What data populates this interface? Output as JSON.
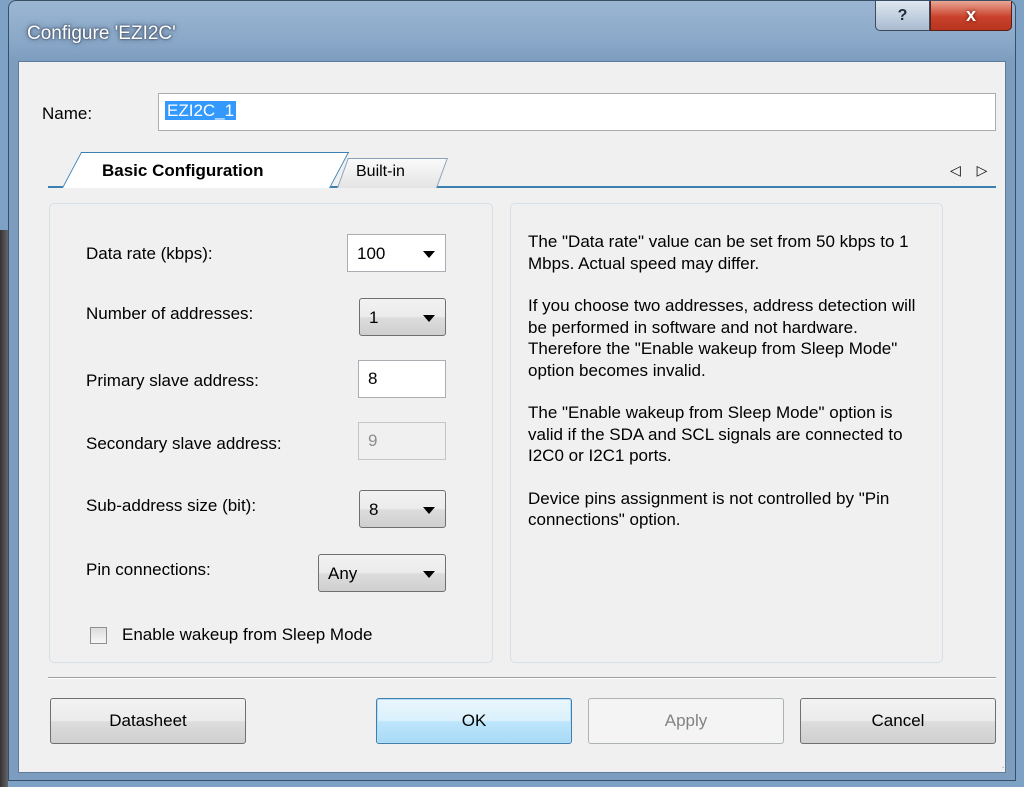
{
  "window": {
    "title": "Configure 'EZI2C'",
    "help_glyph": "?",
    "close_glyph": "x"
  },
  "name": {
    "label": "Name:",
    "value": "EZI2C_1"
  },
  "tabs": [
    {
      "label": "Basic Configuration",
      "active": true
    },
    {
      "label": "Built-in",
      "active": false
    }
  ],
  "tab_scroll": "◁ ▷",
  "form": {
    "data_rate": {
      "label": "Data rate (kbps):",
      "value": "100"
    },
    "num_addresses": {
      "label": "Number of addresses:",
      "value": "1"
    },
    "primary_address": {
      "label": "Primary slave address:",
      "value": "8"
    },
    "secondary_address": {
      "label": "Secondary slave address:",
      "value": "9"
    },
    "subaddress_size": {
      "label": "Sub-address size (bit):",
      "value": "8"
    },
    "pin_connections": {
      "label": "Pin connections:",
      "value": "Any"
    },
    "wakeup": {
      "label": "Enable wakeup from Sleep Mode",
      "checked": false
    }
  },
  "description": [
    "The \"Data rate\" value can be set from 50 kbps to 1 Mbps. Actual speed may differ.",
    "If you choose two addresses, address detection will be performed in software and not hardware. Therefore the \"Enable wakeup from Sleep Mode\" option becomes invalid.",
    "The \"Enable wakeup from Sleep Mode\" option is valid if the SDA and SCL signals are connected to I2C0 or I2C1 ports.",
    "Device pins assignment is not controlled by \"Pin connections\" option."
  ],
  "buttons": {
    "datasheet": "Datasheet",
    "ok": "OK",
    "apply": "Apply",
    "cancel": "Cancel"
  },
  "colors": {
    "accent": "#3c7fb1",
    "selection": "#3399ff",
    "close": "#c9412b"
  }
}
